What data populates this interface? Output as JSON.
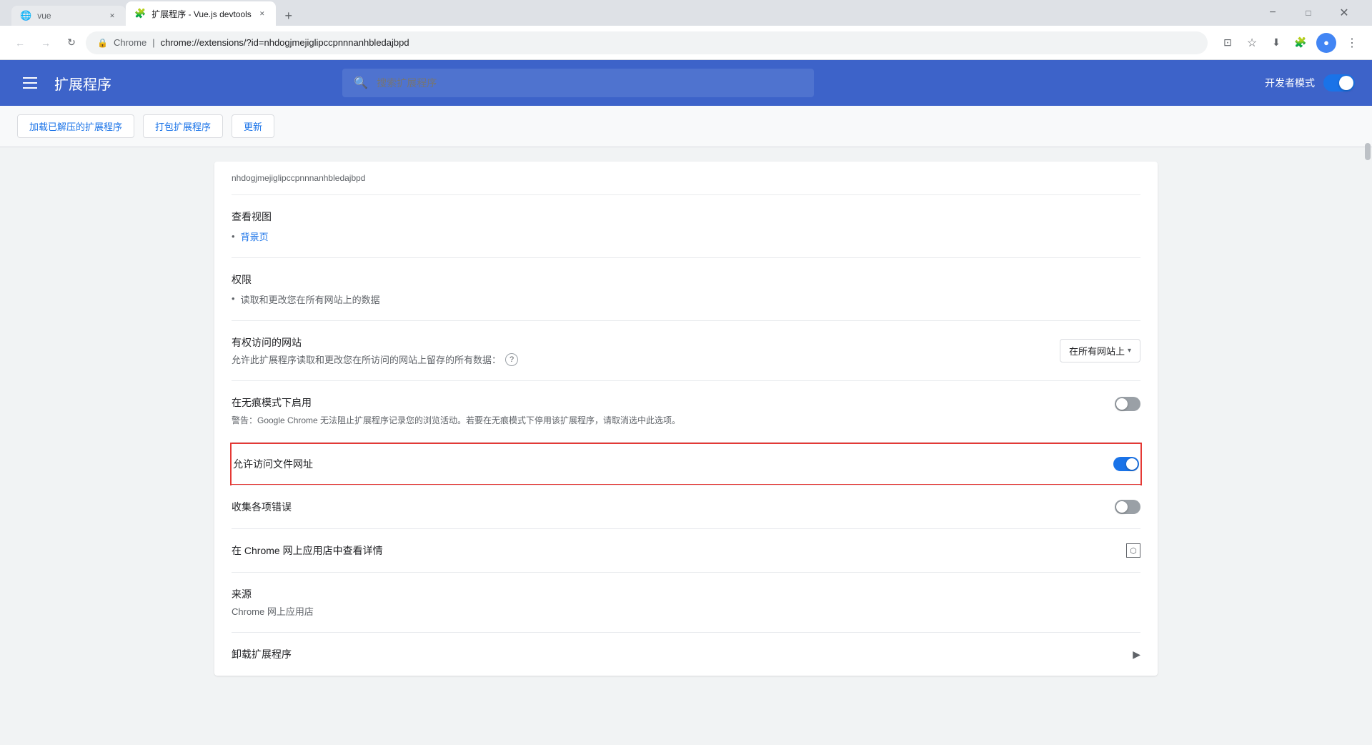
{
  "browser": {
    "tabs": [
      {
        "id": "tab1",
        "favicon": "🌐",
        "title": "vue",
        "active": false,
        "faviconColor": "#4285f4"
      },
      {
        "id": "tab2",
        "favicon": "🧩",
        "title": "扩展程序 - Vue.js devtools",
        "active": true,
        "faviconColor": "#3a57c7"
      }
    ],
    "new_tab_label": "+",
    "address": {
      "icon": "🔒",
      "prefix": "Chrome",
      "separator": "|",
      "url": "chrome://extensions/?id=nhdogjmejiglipccpnnnanhbledajbpd"
    }
  },
  "toolbar": {
    "back_label": "←",
    "forward_label": "→",
    "reload_label": "↻",
    "bookmark_icon": "☆",
    "profile_icon": "👤"
  },
  "header": {
    "menu_label": "☰",
    "title": "扩展程序",
    "search_placeholder": "搜索扩展程序",
    "dev_mode_label": "开发者模式"
  },
  "action_buttons": [
    {
      "label": "加载已解压的扩展程序"
    },
    {
      "label": "打包扩展程序"
    },
    {
      "label": "更新"
    }
  ],
  "ext_detail": {
    "id": "nhdogjmejiglipccpnnnanhbledajbpd",
    "view_section": {
      "title": "查看视图",
      "items": [
        {
          "label": "背景页"
        }
      ]
    },
    "permissions_section": {
      "title": "权限",
      "items": [
        {
          "label": "读取和更改您在所有网站上的数据"
        }
      ]
    },
    "site_access_section": {
      "title": "有权访问的网站",
      "description": "允许此扩展程序读取和更改您在所访问的网站上留存的所有数据：",
      "help_icon": "?",
      "select_value": "在所有网站上",
      "select_arrow": "▾"
    },
    "incognito_section": {
      "title": "在无痕模式下启用",
      "description": "警告：Google Chrome 无法阻止扩展程序记录您的浏览活动。若要在无痕模式下停用该扩展程序，请取消选中此选项。",
      "toggle_state": "off"
    },
    "file_access_section": {
      "title": "允许访问文件网址",
      "toggle_state": "on",
      "highlighted": true
    },
    "errors_section": {
      "title": "收集各项错误",
      "toggle_state": "off"
    },
    "store_section": {
      "title": "在 Chrome 网上应用店中查看详情",
      "icon": "⧉"
    },
    "source_section": {
      "title": "来源",
      "value": "Chrome 网上应用店"
    },
    "uninstall_section": {
      "title": "卸载扩展程序",
      "arrow": "▶"
    }
  },
  "window_controls": {
    "minimize": "−",
    "maximize": "□",
    "close": "×"
  }
}
